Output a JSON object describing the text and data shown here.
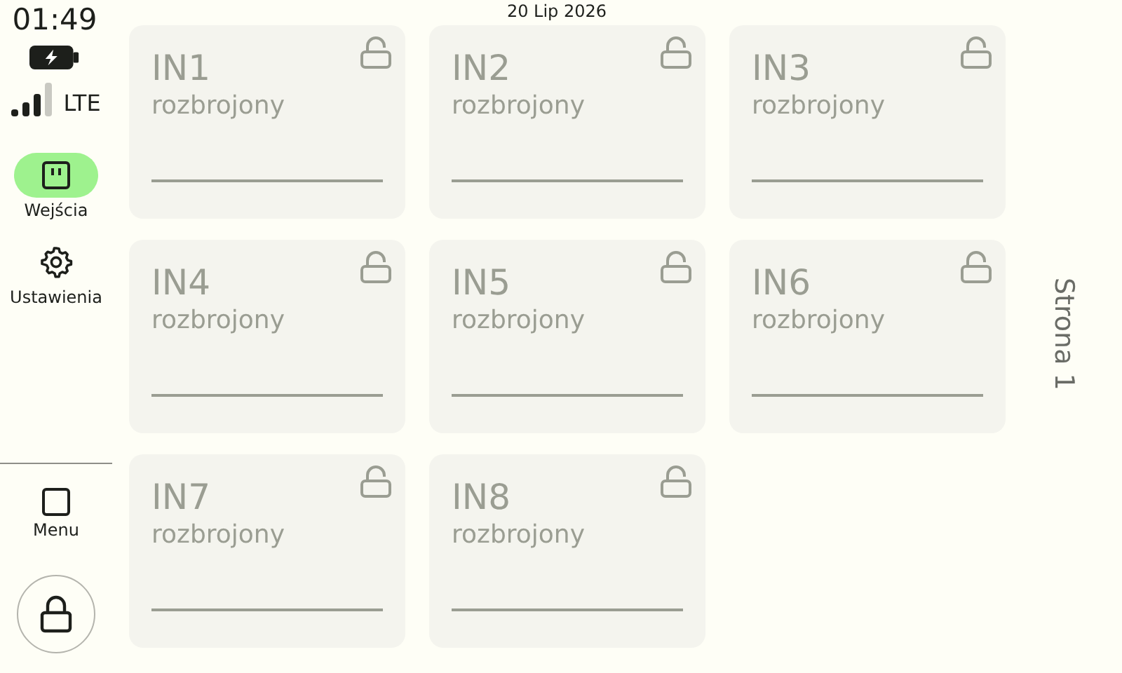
{
  "status": {
    "time": "01:49",
    "battery_charging": true,
    "network": "LTE"
  },
  "date": "20 Lip 2026",
  "nav": [
    {
      "label": "Wejścia",
      "kind": "inputs",
      "selected": true
    },
    {
      "label": "Ustawienia",
      "kind": "gear",
      "selected": false
    }
  ],
  "menu": {
    "label": "Menu"
  },
  "inputs": [
    {
      "name": "IN1",
      "status": "rozbrojony",
      "armed": false
    },
    {
      "name": "IN2",
      "status": "rozbrojony",
      "armed": false
    },
    {
      "name": "IN3",
      "status": "rozbrojony",
      "armed": false
    },
    {
      "name": "IN4",
      "status": "rozbrojony",
      "armed": false
    },
    {
      "name": "IN5",
      "status": "rozbrojony",
      "armed": false
    },
    {
      "name": "IN6",
      "status": "rozbrojony",
      "armed": false
    },
    {
      "name": "IN7",
      "status": "rozbrojony",
      "armed": false
    },
    {
      "name": "IN8",
      "status": "rozbrojony",
      "armed": false
    }
  ],
  "page_label": "Strona 1"
}
